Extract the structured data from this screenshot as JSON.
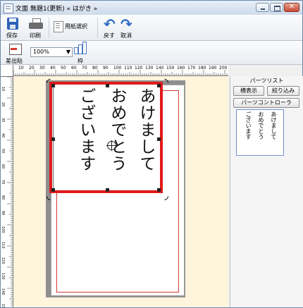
{
  "window": {
    "title": "文面  無題1(更新) « はがき »"
  },
  "toolbar": {
    "save": "保存",
    "print": "印刷",
    "paper_select": "用紙選択",
    "undo": "戻す",
    "cancel": "取消",
    "insert_sender": "差出貼",
    "zoom": "100%",
    "frame": "枠"
  },
  "ruler": {
    "h_ticks": [
      "10",
      "20",
      "30",
      "40",
      "50",
      "60",
      "70",
      "80",
      "90",
      "100",
      "110",
      "120",
      "130",
      "140",
      "150",
      "160",
      "170",
      "180",
      "190",
      "200"
    ],
    "v_ticks": [
      "10",
      "20",
      "30",
      "40",
      "50",
      "60",
      "70",
      "80",
      "90",
      "100",
      "110",
      "120",
      "130",
      "140",
      "150"
    ]
  },
  "card": {
    "lines": [
      "あけまして",
      "おめでとう",
      "ございます"
    ]
  },
  "panel": {
    "title": "パーツリスト",
    "horizontal_display": "横表示",
    "filter": "絞り込み",
    "parts_controller": "パーツコントローラ",
    "thumb_lines": [
      "あけまして",
      "おめでとう",
      "ございます"
    ]
  },
  "colors": {
    "selection": "#e11b1b",
    "card_border": "#d53a3a"
  }
}
